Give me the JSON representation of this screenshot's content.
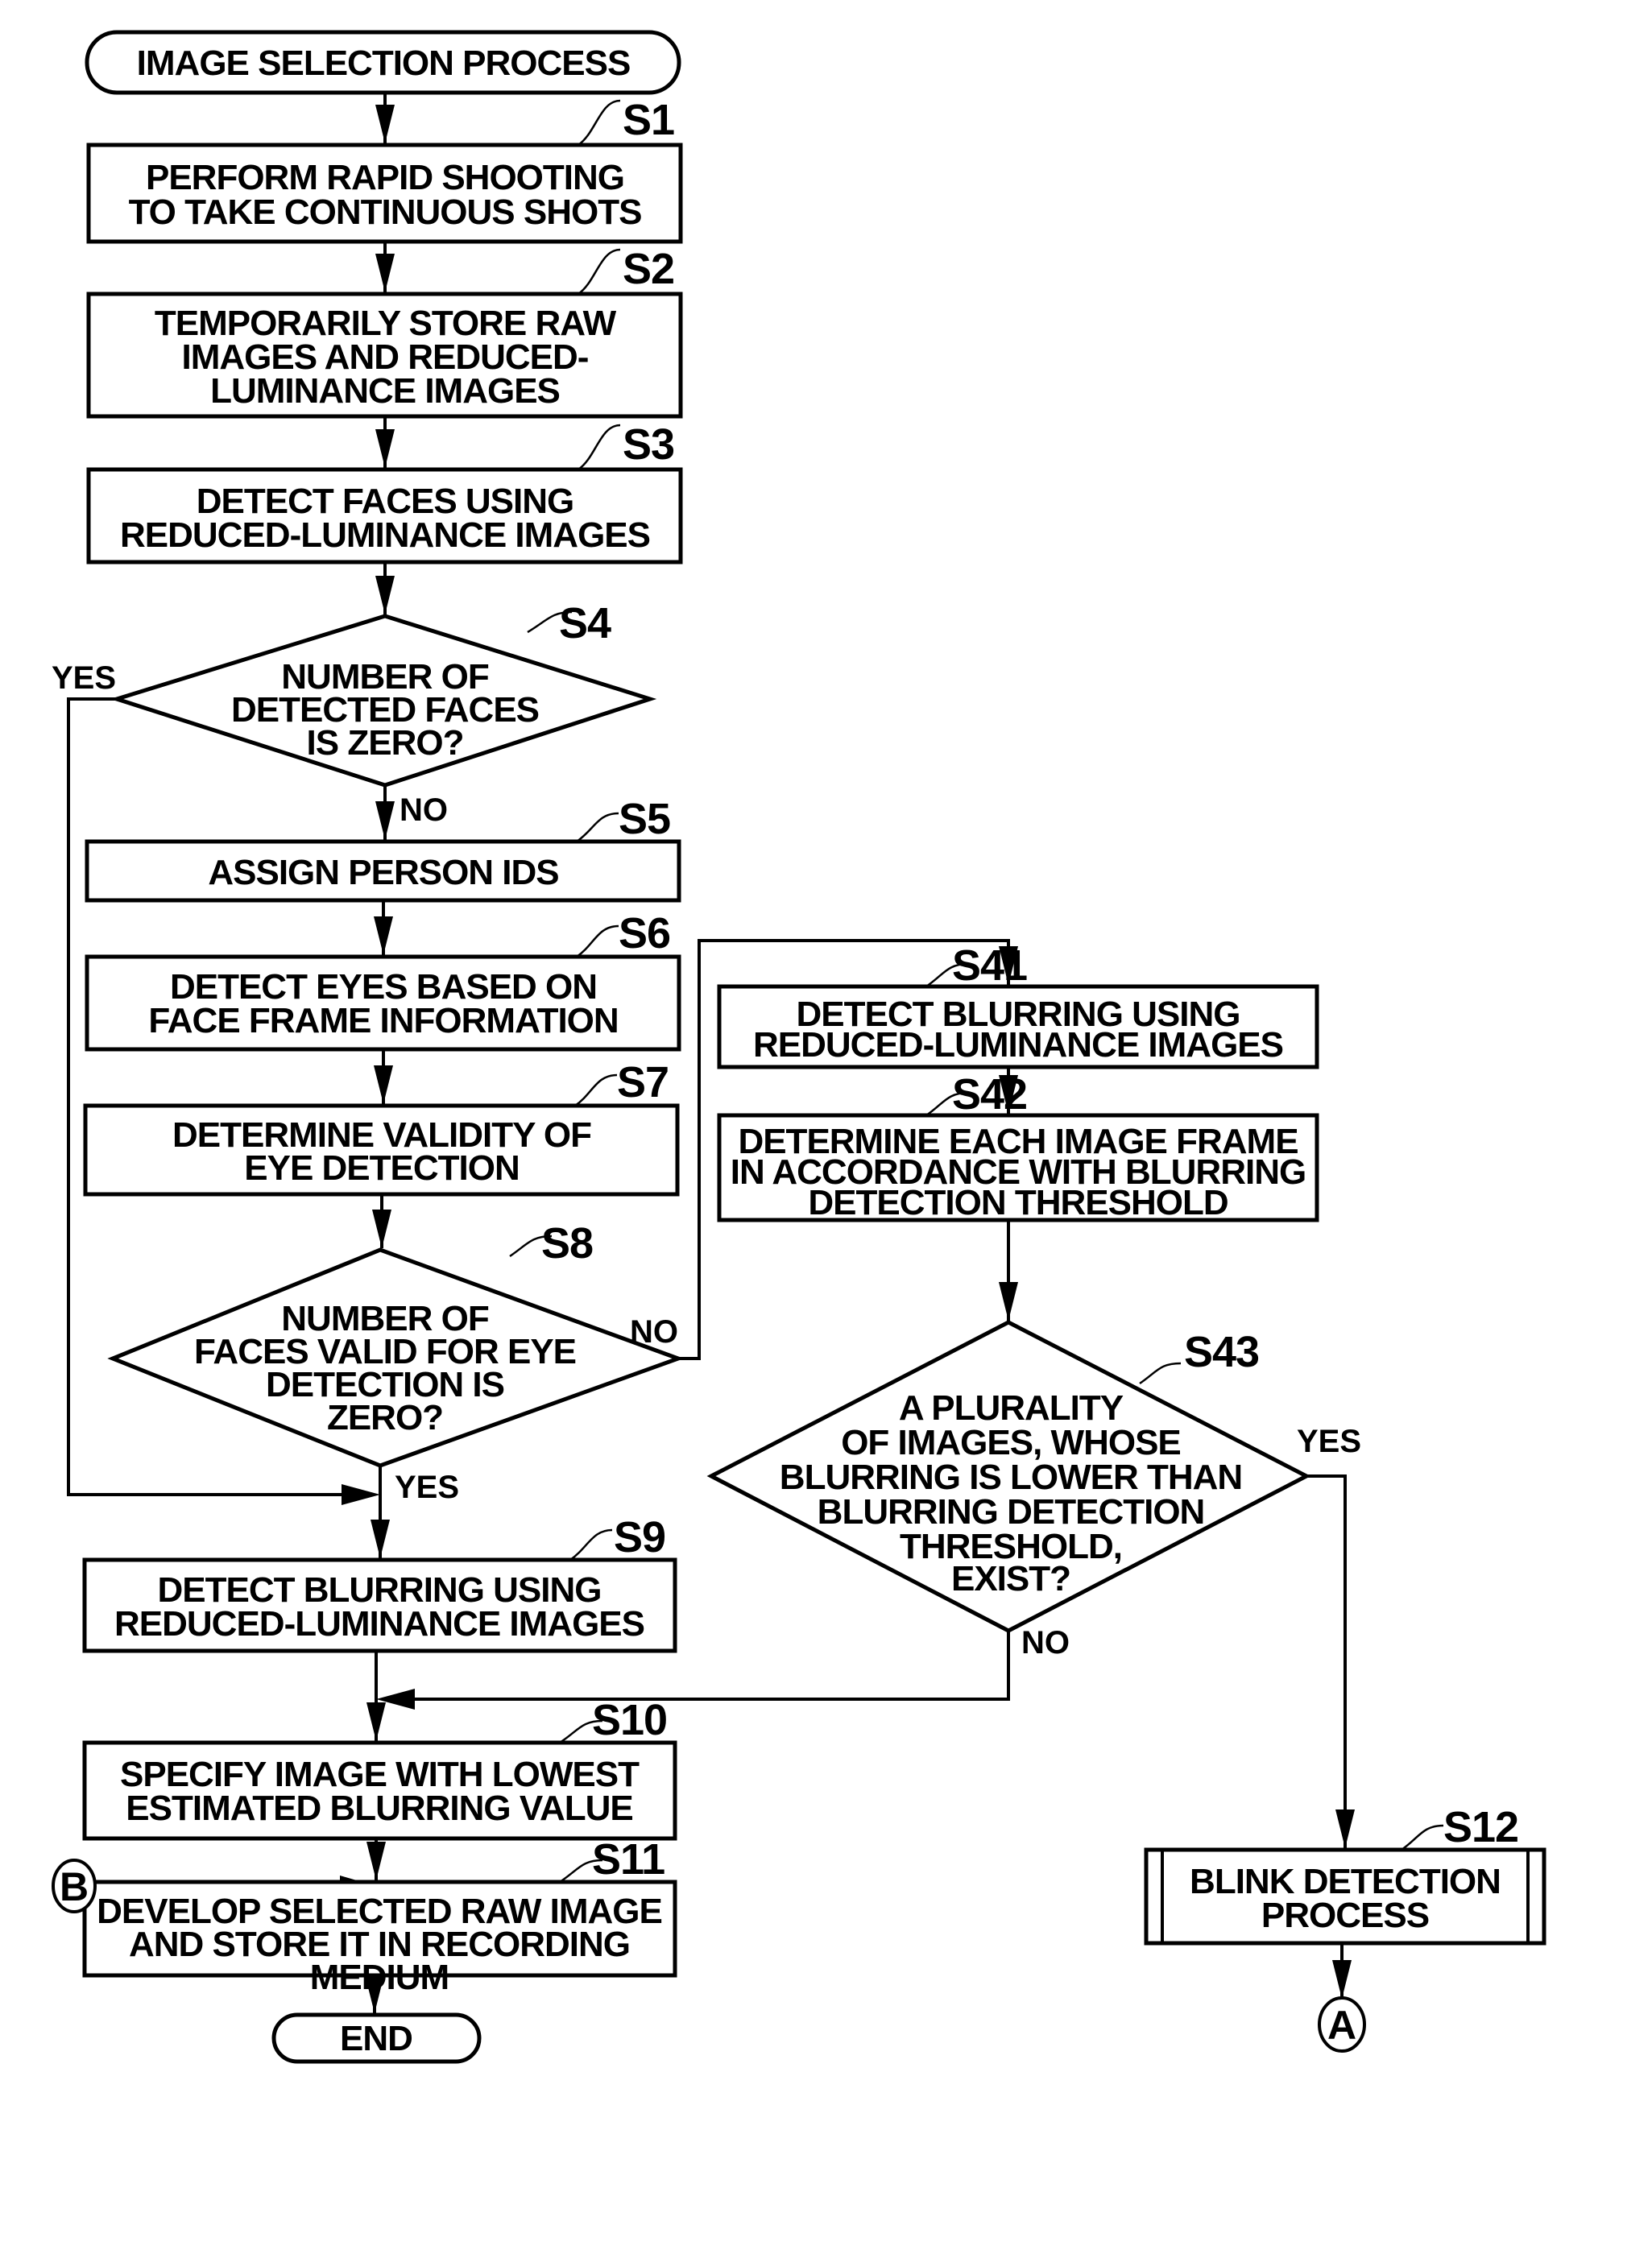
{
  "diagram": {
    "title": "IMAGE SELECTION PROCESS",
    "end_label": "END",
    "steps": {
      "S1": {
        "id": "S1",
        "lines": [
          "PERFORM RAPID SHOOTING",
          "TO TAKE CONTINUOUS SHOTS"
        ]
      },
      "S2": {
        "id": "S2",
        "lines": [
          "TEMPORARILY STORE RAW",
          "IMAGES AND REDUCED-",
          "LUMINANCE IMAGES"
        ]
      },
      "S3": {
        "id": "S3",
        "lines": [
          "DETECT FACES USING",
          "REDUCED-LUMINANCE IMAGES"
        ]
      },
      "S4": {
        "id": "S4",
        "lines": [
          "NUMBER OF",
          "DETECTED FACES",
          "IS ZERO?"
        ]
      },
      "S5": {
        "id": "S5",
        "lines": [
          "ASSIGN PERSON IDS"
        ]
      },
      "S6": {
        "id": "S6",
        "lines": [
          "DETECT EYES BASED ON",
          "FACE FRAME INFORMATION"
        ]
      },
      "S7": {
        "id": "S7",
        "lines": [
          "DETERMINE VALIDITY OF",
          "EYE DETECTION"
        ]
      },
      "S8": {
        "id": "S8",
        "lines": [
          "NUMBER OF",
          "FACES VALID FOR EYE",
          "DETECTION IS",
          "ZERO?"
        ]
      },
      "S9": {
        "id": "S9",
        "lines": [
          "DETECT BLURRING USING",
          "REDUCED-LUMINANCE IMAGES"
        ]
      },
      "S10": {
        "id": "S10",
        "lines": [
          "SPECIFY IMAGE WITH LOWEST",
          "ESTIMATED BLURRING VALUE"
        ]
      },
      "S11": {
        "id": "S11",
        "lines": [
          "DEVELOP SELECTED RAW IMAGE",
          "AND STORE IT IN RECORDING",
          "MEDIUM"
        ]
      },
      "S12": {
        "id": "S12",
        "lines": [
          "BLINK DETECTION",
          "PROCESS"
        ]
      },
      "S41": {
        "id": "S41",
        "lines": [
          "DETECT BLURRING USING",
          "REDUCED-LUMINANCE IMAGES"
        ]
      },
      "S42": {
        "id": "S42",
        "lines": [
          "DETERMINE EACH IMAGE FRAME",
          "IN ACCORDANCE WITH BLURRING",
          "DETECTION THRESHOLD"
        ]
      },
      "S43": {
        "id": "S43",
        "lines": [
          "A PLURALITY",
          "OF IMAGES, WHOSE",
          "BLURRING IS LOWER THAN",
          "BLURRING DETECTION",
          "THRESHOLD,",
          "EXIST?"
        ]
      }
    },
    "branches": {
      "s4_yes": "YES",
      "s4_no": "NO",
      "s8_no": "NO",
      "s8_yes": "YES",
      "s43_yes": "YES",
      "s43_no": "NO"
    },
    "connectors": {
      "a": "A",
      "b": "B"
    }
  }
}
